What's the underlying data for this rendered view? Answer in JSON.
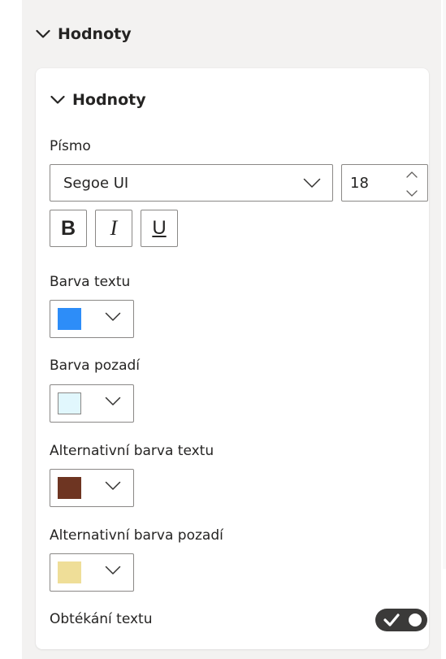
{
  "outer_section": {
    "title": "Hodnoty"
  },
  "card": {
    "title": "Hodnoty"
  },
  "font": {
    "label": "Písmo",
    "family": "Segoe UI",
    "size": "18",
    "bold_label": "B",
    "italic_label": "I",
    "underline_label": "U"
  },
  "text_color": {
    "label": "Barva textu",
    "value": "#2d8df8"
  },
  "background_color": {
    "label": "Barva pozadí",
    "value": "#e1f7fd"
  },
  "alt_text_color": {
    "label": "Alternativní barva textu",
    "value": "#6e3522"
  },
  "alt_background_color": {
    "label": "Alternativní barva pozadí",
    "value": "#efde98"
  },
  "wrap_text": {
    "label": "Obtékání textu",
    "enabled": true
  },
  "icons": {
    "collapse": "chevron-down-icon",
    "dropdown": "chevron-down-icon",
    "spin_up": "chevron-up-icon",
    "spin_down": "chevron-down-icon",
    "toggle_on": "checkmark-icon"
  }
}
